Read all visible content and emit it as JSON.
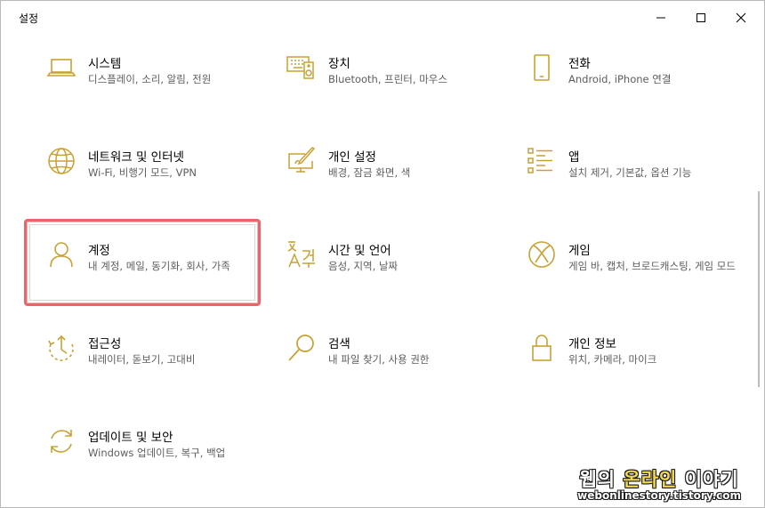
{
  "window": {
    "title": "설정"
  },
  "accent_color": "#c9a133",
  "selection_color": "#e7666b",
  "tiles": [
    {
      "icon": "laptop-icon",
      "name": "시스템",
      "desc": "디스플레이, 소리, 알림, 전원"
    },
    {
      "icon": "keyboard-speaker-icon",
      "name": "장치",
      "desc": "Bluetooth, 프린터, 마우스"
    },
    {
      "icon": "phone-icon",
      "name": "전화",
      "desc": "Android, iPhone 연결"
    },
    {
      "icon": "globe-icon",
      "name": "네트워크 및 인터넷",
      "desc": "Wi-Fi, 비행기 모드, VPN"
    },
    {
      "icon": "paintbrush-monitor-icon",
      "name": "개인 설정",
      "desc": "배경, 잠금 화면, 색"
    },
    {
      "icon": "apps-list-icon",
      "name": "앱",
      "desc": "설치 제거, 기본값, 옵션 기능"
    },
    {
      "icon": "person-icon",
      "name": "계정",
      "desc": "내 계정, 메일, 동기화, 회사, 가족"
    },
    {
      "icon": "language-icon",
      "name": "시간 및 언어",
      "desc": "음성, 지역, 날짜"
    },
    {
      "icon": "xbox-icon",
      "name": "게임",
      "desc": "게임 바, 캡처, 브로드캐스팅, 게임 모드"
    },
    {
      "icon": "ease-of-access-icon",
      "name": "접근성",
      "desc": "내레이터, 돋보기, 고대비"
    },
    {
      "icon": "search-icon",
      "name": "검색",
      "desc": "내 파일 찾기, 사용 권한"
    },
    {
      "icon": "lock-icon",
      "name": "개인 정보",
      "desc": "위치, 카메라, 마이크"
    },
    {
      "icon": "sync-icon",
      "name": "업데이트 및 보안",
      "desc": "Windows 업데이트, 복구, 백업"
    }
  ],
  "watermark": {
    "line1_a": "웹의 ",
    "line1_b": "온라인 ",
    "line1_c": "이야기",
    "line2": "webonlinestory.tistory.com"
  }
}
